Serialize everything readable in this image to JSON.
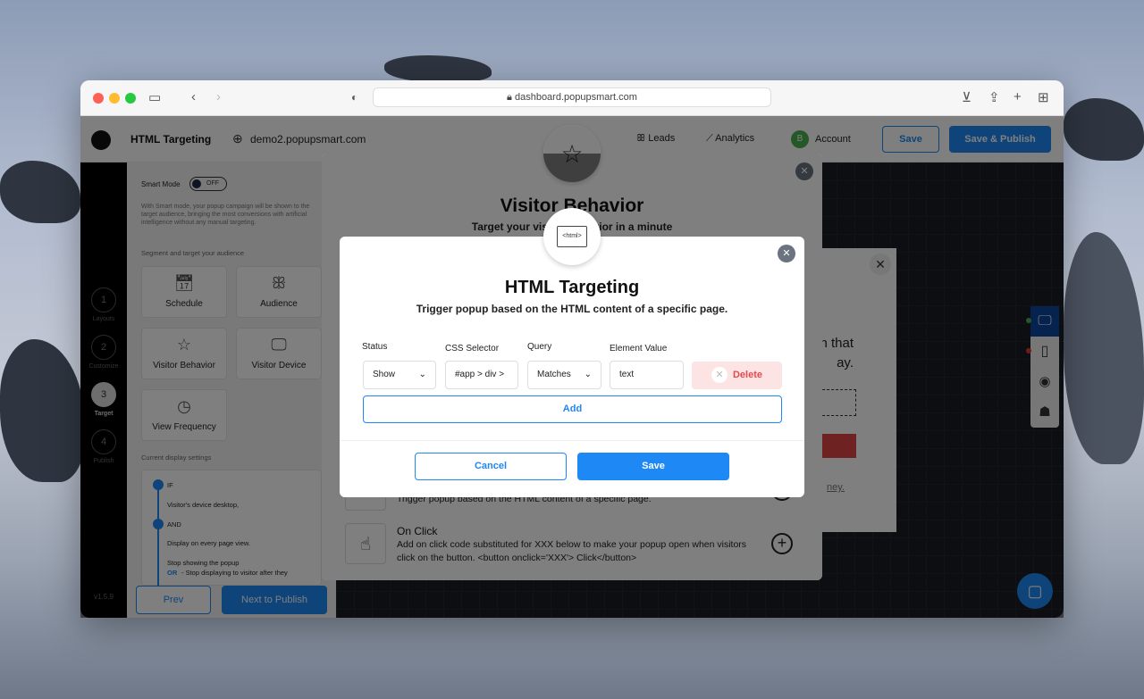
{
  "browser": {
    "url": "dashboard.popupsmart.com"
  },
  "header": {
    "title": "HTML Targeting",
    "domain": "demo2.popupsmart.com",
    "leads": "Leads",
    "analytics": "Analytics",
    "account_initial": "B",
    "account": "Account",
    "save": "Save",
    "save_publish": "Save & Publish"
  },
  "steps": [
    {
      "n": "1",
      "label": "Layouts"
    },
    {
      "n": "2",
      "label": "Customize"
    },
    {
      "n": "3",
      "label": "Target"
    },
    {
      "n": "4",
      "label": "Publish"
    }
  ],
  "version": "v1.5.9",
  "panel": {
    "smart_mode": "Smart Mode",
    "toggle": "OFF",
    "smart_desc": "With Smart mode, your popup campaign will be shown to the target audience, bringing the most conversions with artificial intelligence without any manual targeting.",
    "segment_title": "Segment and target your audience",
    "cards": [
      "Schedule",
      "Audience",
      "Visitor Behavior",
      "Visitor Device",
      "View Frequency"
    ],
    "current_title": "Current display settings",
    "rules": {
      "if": "IF",
      "device": "Visitor's device desktop,",
      "and": "AND",
      "every": "Display on every page view.",
      "stop": "Stop showing the popup",
      "or": "OR",
      "stop2": "- Stop displaying to visitor after they"
    },
    "prev": "Prev",
    "next": "Next to Publish"
  },
  "preview": {
    "line1": "n that",
    "line2": "ay.",
    "link": "ney."
  },
  "visitor_modal": {
    "title": "Visitor Behavior",
    "subtitle": "Target your visitor behavior in a minute",
    "html_desc": "Trigger popup based on the HTML content of a specific page.",
    "onclick_title": "On Click",
    "onclick_desc": "Add on click code substituted for XXX below to make your popup open when visitors click on the button. <button onclick='XXX'> Click</button>"
  },
  "html_modal": {
    "icon_text": "<html>",
    "title": "HTML Targeting",
    "subtitle": "Trigger popup based on the HTML content of a specific page.",
    "labels": {
      "status": "Status",
      "css": "CSS Selector",
      "query": "Query",
      "value": "Element Value"
    },
    "status": "Show",
    "css": "#app > div >",
    "query": "Matches",
    "value": "text",
    "delete": "Delete",
    "add": "Add",
    "cancel": "Cancel",
    "save": "Save"
  },
  "colors": {
    "primary": "#1e88f5",
    "delete_bg": "#fde4e4",
    "delete_text": "#e5484d"
  }
}
